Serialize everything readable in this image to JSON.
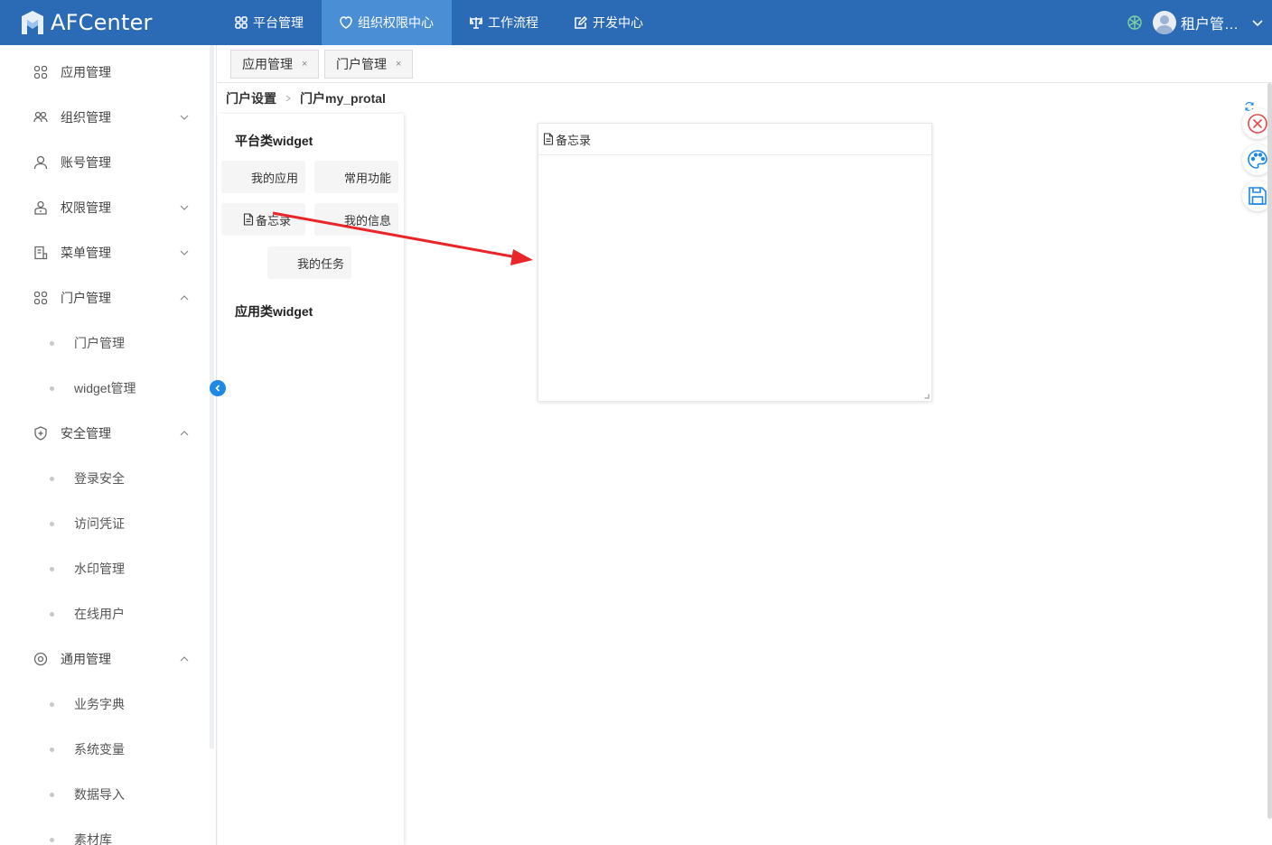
{
  "header": {
    "logo_text": "AFCenter",
    "brand_color": "#2b6bb5",
    "nav": [
      {
        "label": "平台管理",
        "icon": "grid-icon",
        "active": false
      },
      {
        "label": "组织权限中心",
        "icon": "shield-heart-icon",
        "active": true
      },
      {
        "label": "工作流程",
        "icon": "workflow-icon",
        "active": false
      },
      {
        "label": "开发中心",
        "icon": "edit-icon",
        "active": false
      }
    ],
    "user_name": "租户管理员"
  },
  "sidebar": {
    "items": [
      {
        "label": "应用管理",
        "icon": "apps-icon"
      },
      {
        "label": "组织管理",
        "icon": "org-icon",
        "chevron": "down"
      },
      {
        "label": "账号管理",
        "icon": "user-icon"
      },
      {
        "label": "权限管理",
        "icon": "permission-icon",
        "chevron": "down"
      },
      {
        "label": "菜单管理",
        "icon": "menu-icon",
        "chevron": "down"
      },
      {
        "label": "门户管理",
        "icon": "portal-icon",
        "chevron": "up"
      },
      {
        "label": "门户管理",
        "sub": true
      },
      {
        "label": "widget管理",
        "sub": true
      },
      {
        "label": "安全管理",
        "icon": "security-icon",
        "chevron": "up"
      },
      {
        "label": "登录安全",
        "sub": true
      },
      {
        "label": "访问凭证",
        "sub": true
      },
      {
        "label": "水印管理",
        "sub": true
      },
      {
        "label": "在线用户",
        "sub": true
      },
      {
        "label": "通用管理",
        "icon": "settings-icon",
        "chevron": "up"
      },
      {
        "label": "业务字典",
        "sub": true
      },
      {
        "label": "系统变量",
        "sub": true
      },
      {
        "label": "数据导入",
        "sub": true
      },
      {
        "label": "素材库",
        "sub": true
      }
    ]
  },
  "tabs": [
    {
      "label": "应用管理",
      "close": "×"
    },
    {
      "label": "门户管理",
      "close": "×"
    }
  ],
  "breadcrumb": [
    "门户设置",
    "门户my_protal"
  ],
  "widget_panel": {
    "platform_title": "平台类widget",
    "platform_widgets": [
      "我的应用",
      "常用功能",
      "备忘录",
      "我的信息",
      "我的任务"
    ],
    "app_title": "应用类widget"
  },
  "canvas": {
    "memo_title": "备忘录"
  },
  "colors": {
    "accent": "#1e88e5",
    "arrow": "#e8262a",
    "close_red": "#e5484d"
  }
}
